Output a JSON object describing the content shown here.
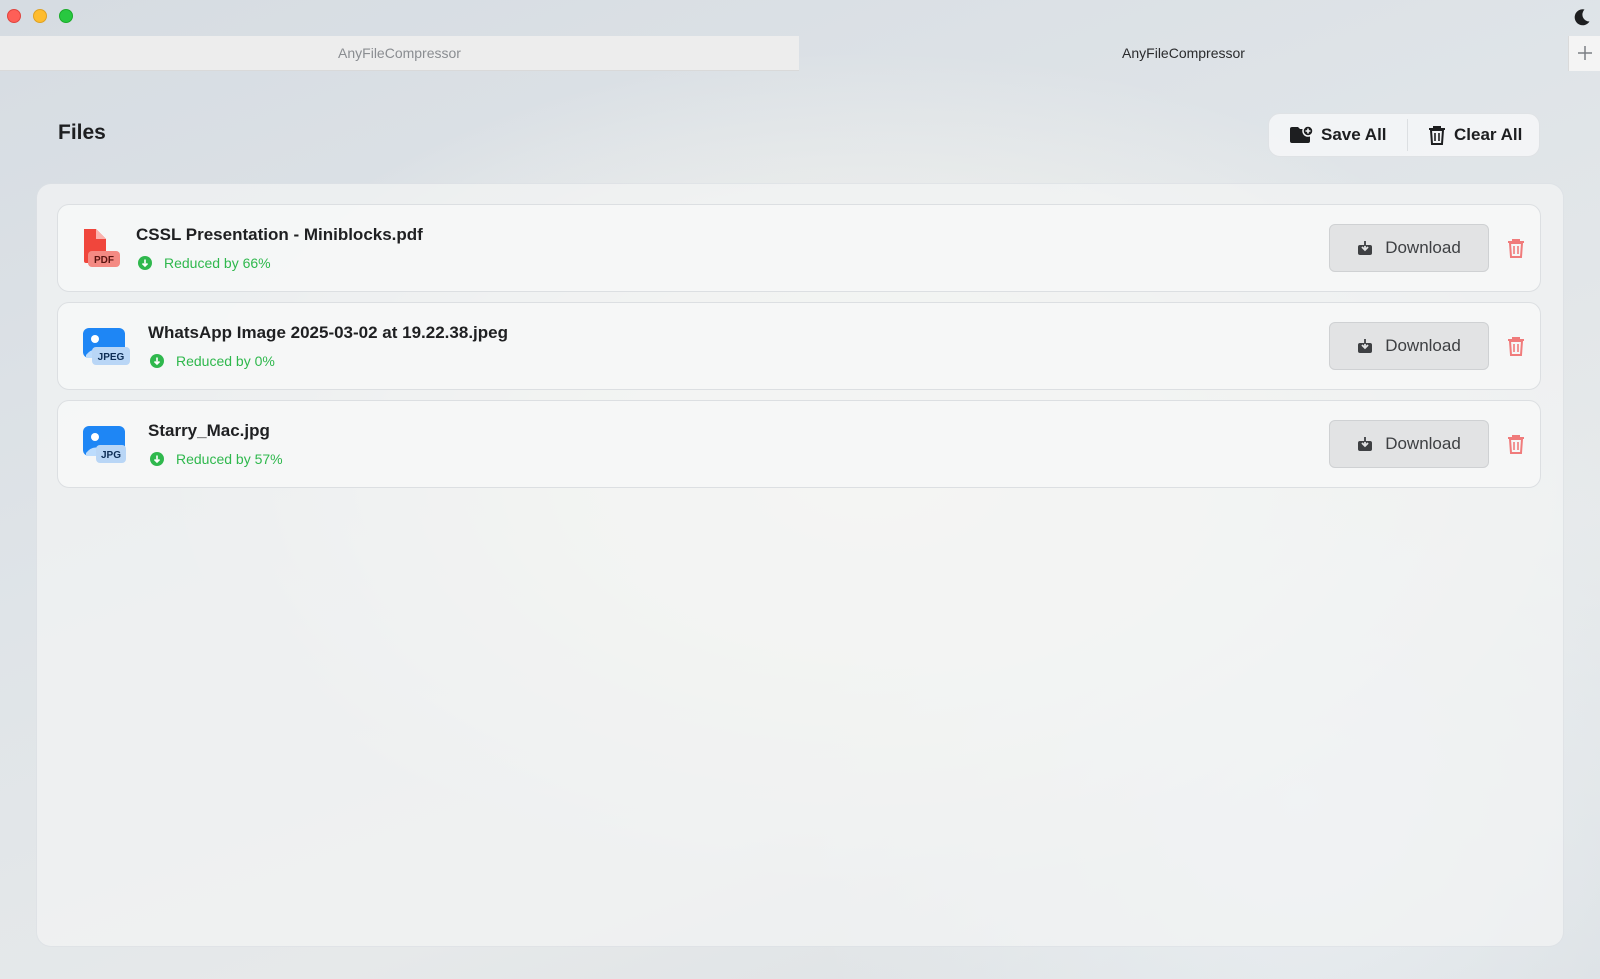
{
  "window": {
    "tabs": [
      {
        "label": "AnyFileCompressor",
        "active": false
      },
      {
        "label": "AnyFileCompressor",
        "active": true
      }
    ],
    "add_tab_icon": "plus-icon",
    "theme_icon": "moon-icon"
  },
  "header": {
    "title": "Files",
    "save_all_label": "Save All",
    "clear_all_label": "Clear All"
  },
  "files": [
    {
      "name": "CSSL Presentation - Miniblocks.pdf",
      "type_badge": "PDF",
      "status": "Reduced by 66%",
      "download_label": "Download"
    },
    {
      "name": "WhatsApp Image 2025-03-02 at 19.22.38.jpeg",
      "type_badge": "JPEG",
      "status": "Reduced by 0%",
      "download_label": "Download"
    },
    {
      "name": "Starry_Mac.jpg",
      "type_badge": "JPG",
      "status": "Reduced by 57%",
      "download_label": "Download"
    }
  ],
  "colors": {
    "status_green": "#2fb84d",
    "pdf_red": "#f0463c",
    "image_blue": "#1e86f5",
    "trash_red": "#f07b7b"
  }
}
